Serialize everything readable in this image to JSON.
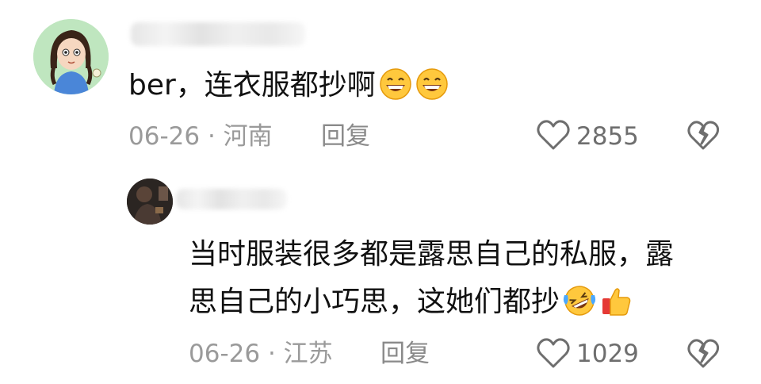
{
  "comments": [
    {
      "avatar_icon": "girl-avatar-icon",
      "text": "ber，连衣服都抄啊",
      "emojis": [
        "grinning-face-icon",
        "grinning-face-icon"
      ],
      "date": "06-26",
      "separator": "·",
      "location": "河南",
      "reply_label": "回复",
      "likes": "2855"
    },
    {
      "avatar_icon": "dark-photo-avatar-icon",
      "text_line1": "当时服装很多都是露思自己的私服，露",
      "text_line2": "思自己的小巧思，这她们都抄",
      "emojis": [
        "rolling-laughing-face-icon",
        "thumbs-up-icon"
      ],
      "date": "06-26",
      "separator": "·",
      "location": "江苏",
      "reply_label": "回复",
      "likes": "1029"
    }
  ]
}
